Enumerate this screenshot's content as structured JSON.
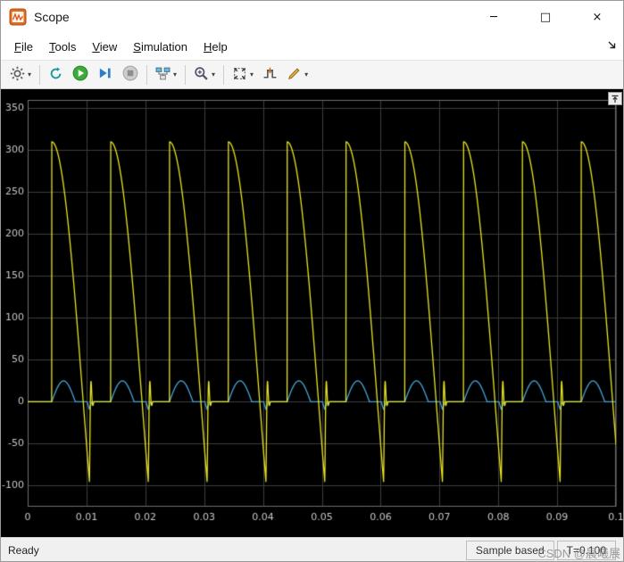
{
  "window": {
    "title": "Scope",
    "controls": {
      "minimize": "─",
      "maximize": "□",
      "close": "×"
    }
  },
  "menu": {
    "items": [
      {
        "key": "F",
        "rest": "ile"
      },
      {
        "key": "T",
        "rest": "ools"
      },
      {
        "key": "V",
        "rest": "iew"
      },
      {
        "key": "S",
        "rest": "imulation"
      },
      {
        "key": "H",
        "rest": "elp"
      }
    ]
  },
  "toolbar": {
    "buttons": [
      {
        "name": "settings",
        "icon": "gear-icon",
        "dropdown": true
      },
      {
        "name": "stepping-options",
        "icon": "circular-arrow-icon",
        "dropdown": false
      },
      {
        "name": "run",
        "icon": "play-icon",
        "dropdown": false
      },
      {
        "name": "step-forward",
        "icon": "step-forward-icon",
        "dropdown": false
      },
      {
        "name": "stop",
        "icon": "stop-icon",
        "dropdown": false
      },
      {
        "name": "signal-selector",
        "icon": "flowchart-icon",
        "dropdown": true
      },
      {
        "name": "zoom",
        "icon": "magnifier-icon",
        "dropdown": true
      },
      {
        "name": "fit-to-view",
        "icon": "fit-view-icon",
        "dropdown": true
      },
      {
        "name": "trigger",
        "icon": "trigger-icon",
        "dropdown": false
      },
      {
        "name": "measurements",
        "icon": "pencil-icon",
        "dropdown": true
      }
    ]
  },
  "chart_data": {
    "type": "line",
    "title": "",
    "xlabel": "",
    "ylabel": "",
    "xlim": [
      0,
      0.1
    ],
    "ylim": [
      -125,
      360
    ],
    "x_ticks": {
      "values": [
        0,
        0.01,
        0.02,
        0.03,
        0.04,
        0.05,
        0.06,
        0.07,
        0.08,
        0.09,
        0.1
      ],
      "labels": [
        "0",
        "0.01",
        "0.02",
        "0.03",
        "0.04",
        "0.05",
        "0.06",
        "0.07",
        "0.08",
        "0.09",
        "0.1"
      ]
    },
    "y_ticks": {
      "values": [
        -100,
        -50,
        0,
        50,
        100,
        150,
        200,
        250,
        300,
        350
      ],
      "labels": [
        "-100",
        "-50",
        "0",
        "50",
        "100",
        "150",
        "200",
        "250",
        "300",
        "350"
      ]
    },
    "grid": true,
    "background": "#000000",
    "grid_color": "#3d3d3d",
    "border_color": "#6f6f6f",
    "tick_color": "#c8c8c8",
    "sample_step": 2e-05,
    "series": [
      {
        "name": "channel-1-voltage",
        "color": "#e8e41f",
        "shape": {
          "kind": "cos-decay-pulse",
          "period": 0.01,
          "start": 0.0041,
          "peak": 310,
          "trough": -95,
          "decay": 0.0064,
          "recover": 0.0009
        }
      },
      {
        "name": "channel-2-current",
        "color": "#46a4d9",
        "shape": {
          "kind": "half-sine-pulse",
          "period": 0.01,
          "start": 0.0041,
          "width": 0.004,
          "peak": 25,
          "dip_at": 0.0064,
          "dip_depth": -9,
          "dip_width": 0.0004
        }
      }
    ]
  },
  "statusbar": {
    "ready": "Ready",
    "sample_mode": "Sample based",
    "time": "T=0.100",
    "watermark": "CSDN @晨曦展"
  }
}
